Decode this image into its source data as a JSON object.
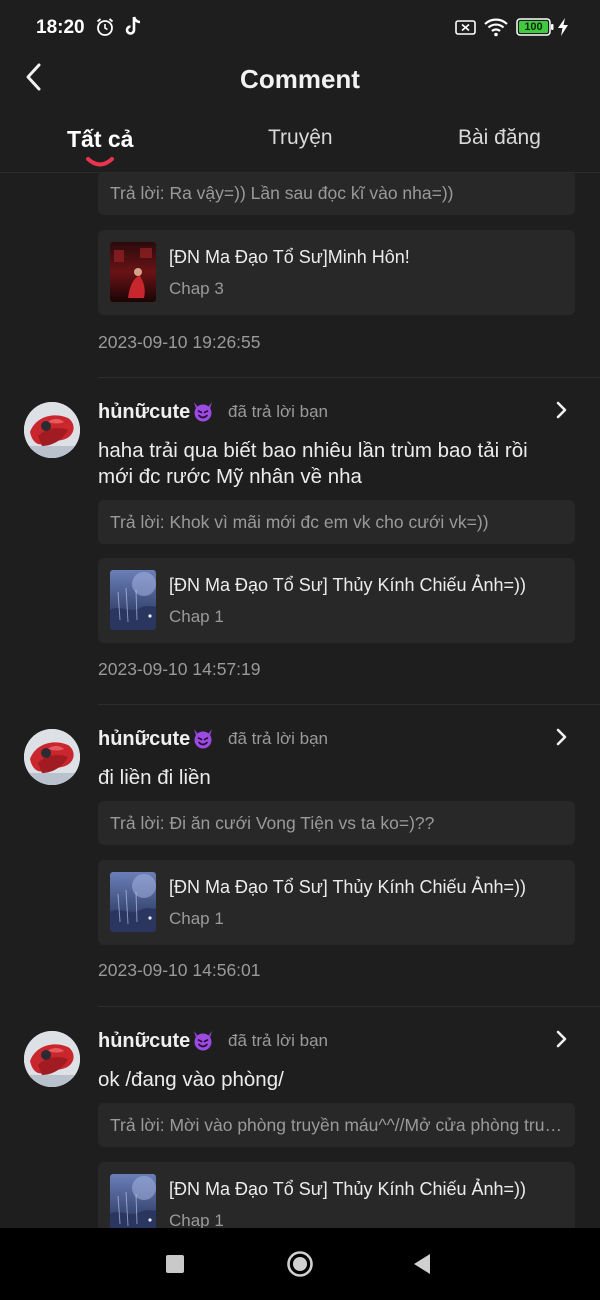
{
  "status_bar": {
    "time": "18:20",
    "battery": "100",
    "icons": [
      "alarm-icon",
      "tiktok-icon",
      "no-sim-icon",
      "wifi-icon",
      "battery-icon",
      "charging-icon"
    ]
  },
  "header": {
    "title": "Comment"
  },
  "tabs": [
    {
      "label": "Tất cả",
      "active": true
    },
    {
      "label": "Truyện",
      "active": false
    },
    {
      "label": "Bài đăng",
      "active": false
    }
  ],
  "colors": {
    "background": "#1e1e1e",
    "card": "#282828",
    "accent": "#e8344e"
  },
  "partial_item": {
    "reply": "Trả lời: Ra vậy=)) Lần sau đọc kĩ vào nha=))",
    "story_title": "[ĐN Ma Đạo Tổ Sư]Minh Hôn!",
    "story_chapter": "Chap 3",
    "timestamp": "2023-09-10 19:26:55"
  },
  "notifications": [
    {
      "user": "hủnữcute",
      "action": "đã trả lời bạn",
      "comment": "haha trải qua biết bao nhiêu lần trùm bao tải rồi mới đc rước Mỹ nhân về nha",
      "reply": "Trả lời: Khok vì mãi mới đc em vk cho cưới vk=))",
      "story_title": "[ĐN Ma Đạo Tổ Sư] Thủy Kính Chiếu Ảnh=))",
      "story_chapter": "Chap 1",
      "timestamp": "2023-09-10 14:57:19"
    },
    {
      "user": "hủnữcute",
      "action": "đã trả lời bạn",
      "comment": "đi liền đi liền",
      "reply": "Trả lời: Đi ăn cưới Vong Tiện vs ta ko=)??",
      "story_title": "[ĐN Ma Đạo Tổ Sư] Thủy Kính Chiếu Ảnh=))",
      "story_chapter": "Chap 1",
      "timestamp": "2023-09-10 14:56:01"
    },
    {
      "user": "hủnữcute",
      "action": "đã trả lời bạn",
      "comment": "ok /đang vào phòng/",
      "reply": "Trả lời: Mời vào phòng truyền máu^^//Mở cửa phòng truyền máu",
      "story_title": "[ĐN Ma Đạo Tổ Sư] Thủy Kính Chiếu Ảnh=))",
      "story_chapter": "Chap 1",
      "timestamp": ""
    }
  ]
}
